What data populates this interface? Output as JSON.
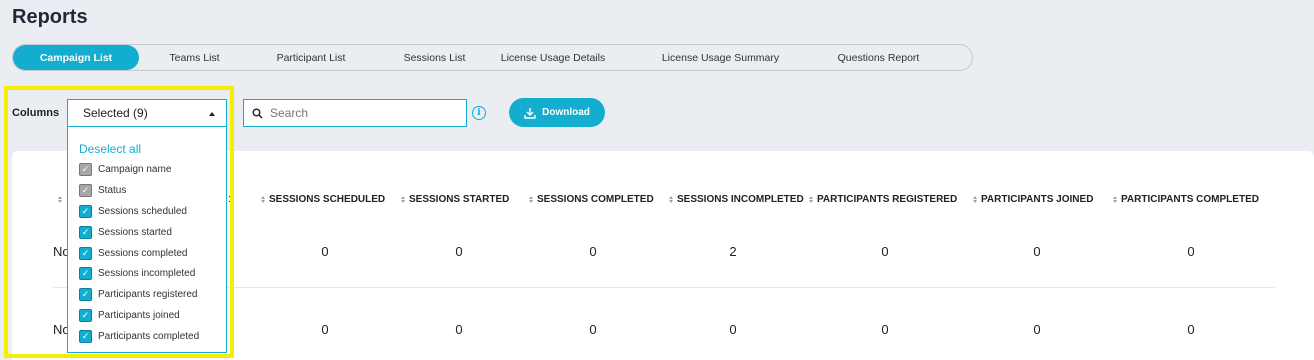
{
  "page": {
    "title": "Reports"
  },
  "tabs": [
    {
      "label": "Campaign List",
      "active": true
    },
    {
      "label": "Teams List",
      "active": false
    },
    {
      "label": "Participant List",
      "active": false
    },
    {
      "label": "Sessions List",
      "active": false
    },
    {
      "label": "License Usage Details",
      "active": false
    },
    {
      "label": "License Usage Summary",
      "active": false
    },
    {
      "label": "Questions Report",
      "active": false
    }
  ],
  "toolbar": {
    "columns_label": "Columns",
    "columns_select_value": "Selected (9)",
    "search_placeholder": "Search",
    "info_glyph": "i",
    "download_label": "Download"
  },
  "dropdown": {
    "deselect_label": "Deselect all",
    "options": [
      {
        "label": "Campaign name",
        "checked": true,
        "disabled": true
      },
      {
        "label": "Status",
        "checked": true,
        "disabled": true
      },
      {
        "label": "Sessions scheduled",
        "checked": true,
        "disabled": false
      },
      {
        "label": "Sessions started",
        "checked": true,
        "disabled": false
      },
      {
        "label": "Sessions completed",
        "checked": true,
        "disabled": false
      },
      {
        "label": "Sessions incompleted",
        "checked": true,
        "disabled": false
      },
      {
        "label": "Participants registered",
        "checked": true,
        "disabled": false
      },
      {
        "label": "Participants joined",
        "checked": true,
        "disabled": false
      },
      {
        "label": "Participants completed",
        "checked": true,
        "disabled": false
      }
    ]
  },
  "table": {
    "headers": [
      "SESSIONS SCHEDULED",
      "SESSIONS STARTED",
      "SESSIONS COMPLETED",
      "SESSIONS INCOMPLETED",
      "PARTICIPANTS REGISTERED",
      "PARTICIPANTS JOINED",
      "PARTICIPANTS COMPLETED"
    ],
    "rows": [
      {
        "status_partial": "No",
        "values": [
          "0",
          "0",
          "0",
          "2",
          "0",
          "0",
          "0"
        ]
      },
      {
        "status_partial": "No",
        "values": [
          "0",
          "0",
          "0",
          "0",
          "0",
          "0",
          "0"
        ]
      }
    ]
  },
  "colors": {
    "accent": "#13aecf",
    "highlight": "#f5ee00",
    "background": "#eaedf2"
  }
}
